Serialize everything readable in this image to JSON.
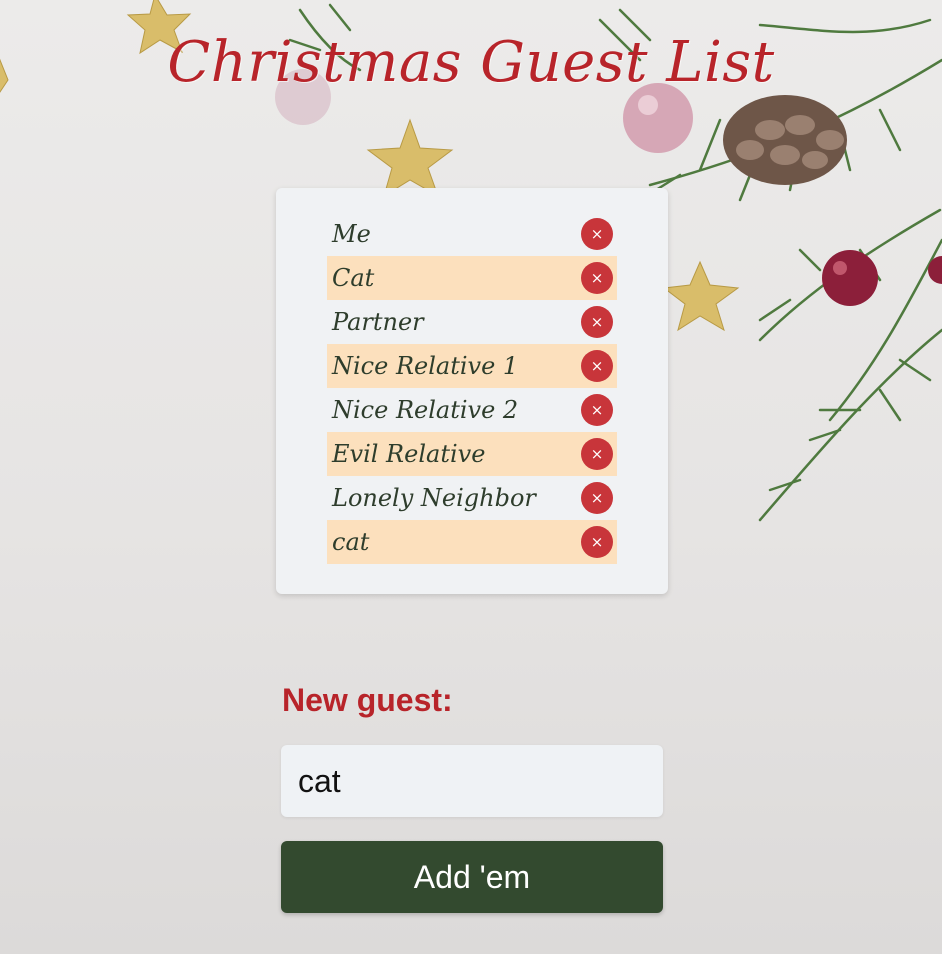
{
  "page": {
    "title": "Christmas Guest List"
  },
  "guests": [
    {
      "name": "Me",
      "remove": "×"
    },
    {
      "name": "Cat",
      "remove": "×"
    },
    {
      "name": "Partner",
      "remove": "×"
    },
    {
      "name": "Nice Relative 1",
      "remove": "×"
    },
    {
      "name": "Nice Relative 2",
      "remove": "×"
    },
    {
      "name": "Evil Relative",
      "remove": "×"
    },
    {
      "name": "Lonely Neighbor",
      "remove": "×"
    },
    {
      "name": "cat",
      "remove": "×"
    }
  ],
  "form": {
    "label": "New guest:",
    "input_value": "cat",
    "submit_label": "Add 'em"
  },
  "colors": {
    "title": "#b8242a",
    "row_highlight": "#fce0bd",
    "remove_button": "#c8353a",
    "submit_button": "#334a2f"
  },
  "decor_icons": [
    "gold-star-icon",
    "pine-branch-icon",
    "pinecone-icon",
    "ornament-ball-icon",
    "berry-icon"
  ]
}
